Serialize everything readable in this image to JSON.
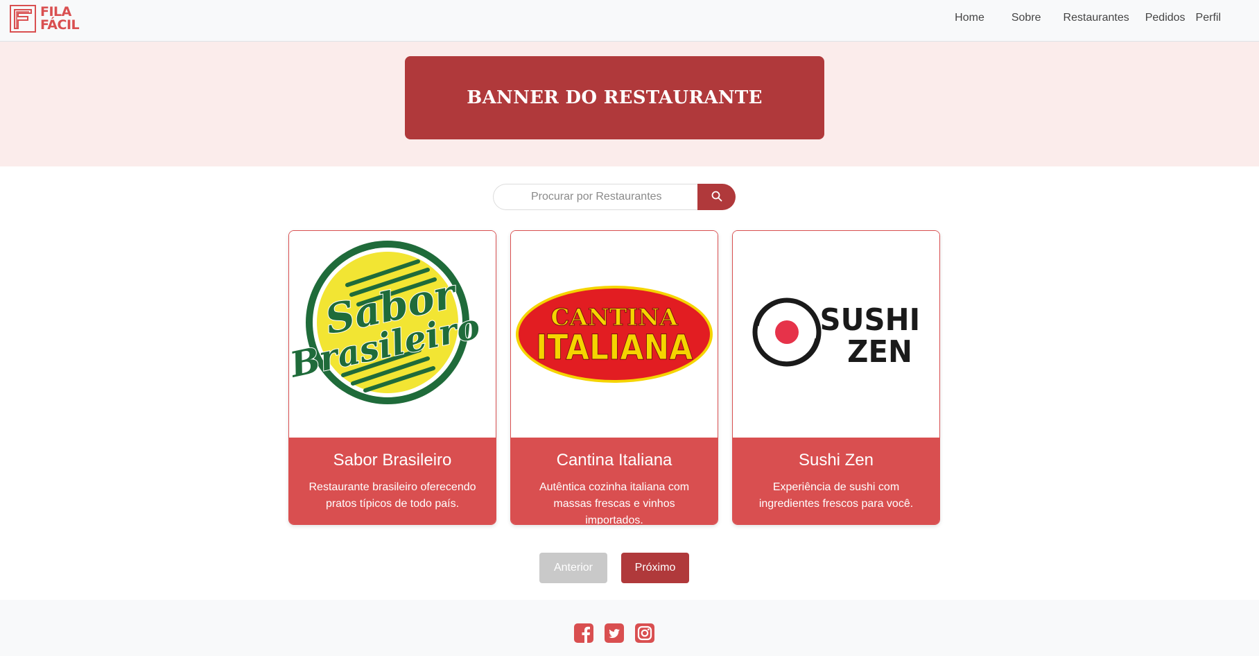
{
  "header": {
    "logo_text_line1": "FILA",
    "logo_text_line2": "FÁCIL",
    "nav": [
      {
        "label": "Home"
      },
      {
        "label": "Sobre"
      },
      {
        "label": "Restaurantes"
      },
      {
        "label": "Pedidos"
      },
      {
        "label": "Perfil"
      }
    ]
  },
  "banner": {
    "title": "BANNER DO RESTAURANTE"
  },
  "search": {
    "placeholder": "Procurar por Restaurantes",
    "icon": "search-icon"
  },
  "restaurants": [
    {
      "name": "Sabor Brasileiro",
      "description": "Restaurante brasileiro oferecendo pratos típicos de todo país.",
      "logo_line1": "Sabor",
      "logo_line2": "Brasileiro"
    },
    {
      "name": "Cantina Italiana",
      "description": "Autêntica cozinha italiana com massas frescas e vinhos importados.",
      "logo_line1": "CANTINA",
      "logo_line2": "ITALIANA"
    },
    {
      "name": "Sushi Zen",
      "description": "Experiência de sushi com ingredientes frescos para você.",
      "logo_line1": "SUSHI",
      "logo_line2": "ZEN"
    }
  ],
  "pagination": {
    "prev_label": "Anterior",
    "next_label": "Próximo",
    "prev_disabled": true
  },
  "footer": {
    "social": [
      "facebook-icon",
      "twitter-icon",
      "instagram-icon"
    ]
  },
  "colors": {
    "brand_red": "#d94f50",
    "dark_red": "#b0393b",
    "banner_bg": "#fbeceb",
    "disabled_gray": "#c9c9c9"
  }
}
